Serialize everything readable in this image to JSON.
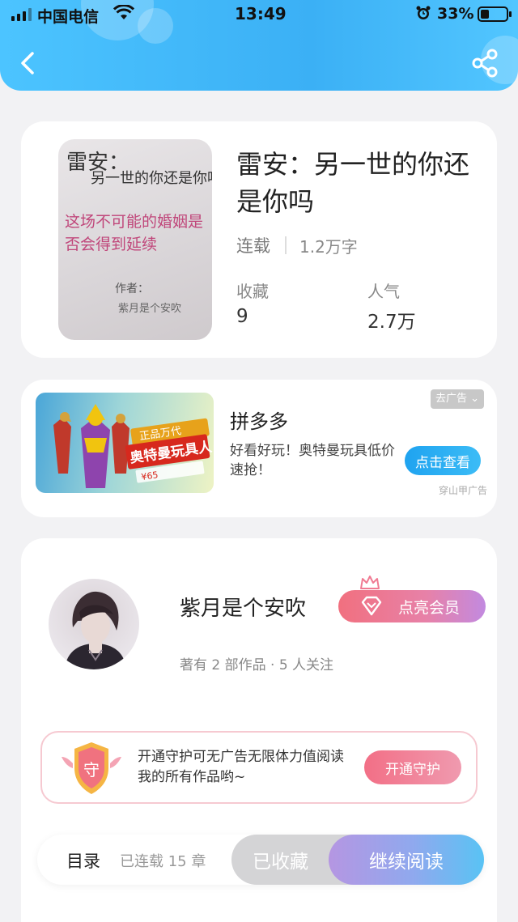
{
  "status_bar": {
    "carrier": "中国电信",
    "time": "13:49",
    "battery": "33%"
  },
  "header": {
    "back_icon": "chevron-left-icon",
    "share_icon": "share-icon"
  },
  "book": {
    "title": "雷安：另一世的你还是你吗",
    "status": "连载",
    "word_count": "1.2万字",
    "favorites_label": "收藏",
    "favorites_value": "9",
    "popularity_label": "人气",
    "popularity_value": "2.7万",
    "cover": {
      "line1": "雷安：",
      "line2": "另一世的你还是你吗",
      "line3": "这场不可能的婚姻是否会得到延续",
      "line4": "作者：",
      "line5": "紫月是个安吹"
    }
  },
  "ad": {
    "close_label": "去广告",
    "title": "拼多多",
    "description": "好看好玩！奥特曼玩具低价速抢！",
    "button_label": "点击查看",
    "source": "穿山甲广告",
    "image": {
      "banner_line1": "正品万代",
      "banner_line2": "奥特曼玩具人",
      "price": "¥65"
    }
  },
  "author": {
    "name": "紫月是个安吹",
    "vip_button_label": "点亮会员",
    "stats": "著有 2 部作品 · 5 人关注",
    "guard": {
      "badge": "守",
      "text": "开通守护可无广告无限体力值阅读我的所有作品哟~",
      "button_label": "开通守护"
    }
  },
  "bottom_bar": {
    "toc_label": "目录",
    "chapters_label": "已连载 15 章",
    "collected_label": "已收藏",
    "continue_label": "继续阅读"
  },
  "colors": {
    "header_blue": "#3bb0f5",
    "vip_pink": "#f1707f",
    "continue_gradient_end": "#59c3f4"
  }
}
